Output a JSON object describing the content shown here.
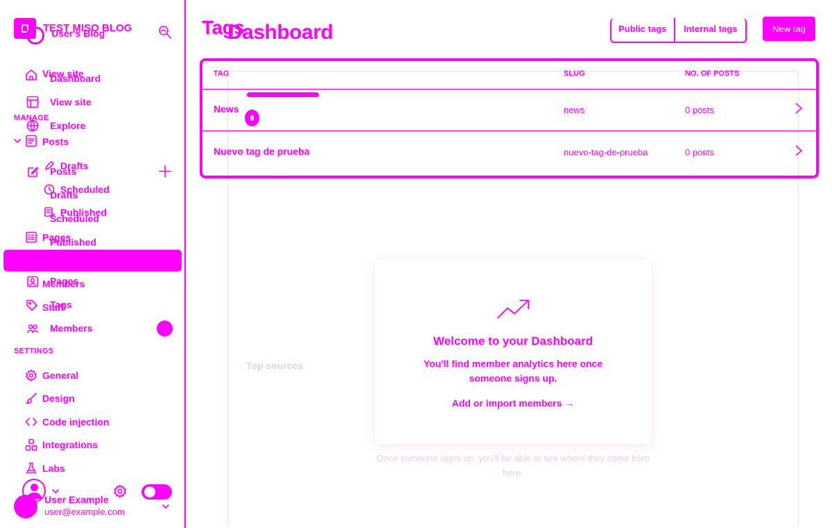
{
  "sidebar": {
    "site_title": "TEST MISO BLOG",
    "site_title_ghost": "User's Blog",
    "nav_top": {
      "view_site_1": "View site",
      "dashboard": "Dashboard",
      "view_site_2": "View site",
      "explore": "Explore"
    },
    "manage_header": "MANAGE",
    "posts": "Posts",
    "posts_ghost": "Posts",
    "drafts": "Drafts",
    "drafts_ghost": "Drafts",
    "scheduled": "Scheduled",
    "scheduled_ghost": "Scheduled",
    "published": "Published",
    "published_ghost": "Published",
    "pages": "Pages",
    "pages_ghost": "Pages",
    "members_ghost": "Members",
    "staff_ghost": "Staff",
    "tags": "Tags",
    "members": "Members",
    "settings_header": "SETTINGS",
    "settings_items": [
      "General",
      "Design",
      "Code injection",
      "Integrations",
      "Labs"
    ],
    "user": {
      "name": "User Example",
      "email": "user@example.com"
    }
  },
  "main": {
    "title_tags": "Tags",
    "title_dashboard": "Dashboard",
    "tab_public": "Public tags",
    "tab_internal": "Internal tags",
    "new_tag_button": "New tag",
    "table": {
      "headers": [
        "TAG",
        "SLUG",
        "NO. OF POSTS"
      ],
      "rows": [
        {
          "name": "News",
          "slug": "news",
          "count": "0 posts"
        },
        {
          "name": "Nuevo tag de prueba",
          "slug": "nuevo-tag-de-prueba",
          "count": "0 posts"
        }
      ]
    },
    "background": {
      "top_sources": "Top sources",
      "helper": "Once someone signs up, you'll be able to see where they came from here."
    },
    "welcome_card": {
      "title": "Welcome to your Dashboard",
      "description": "You'll find member analytics here once someone signs up.",
      "link": "Add or import members →"
    }
  },
  "colors": {
    "accent": "#ff00ff",
    "background": "#ffffff"
  }
}
